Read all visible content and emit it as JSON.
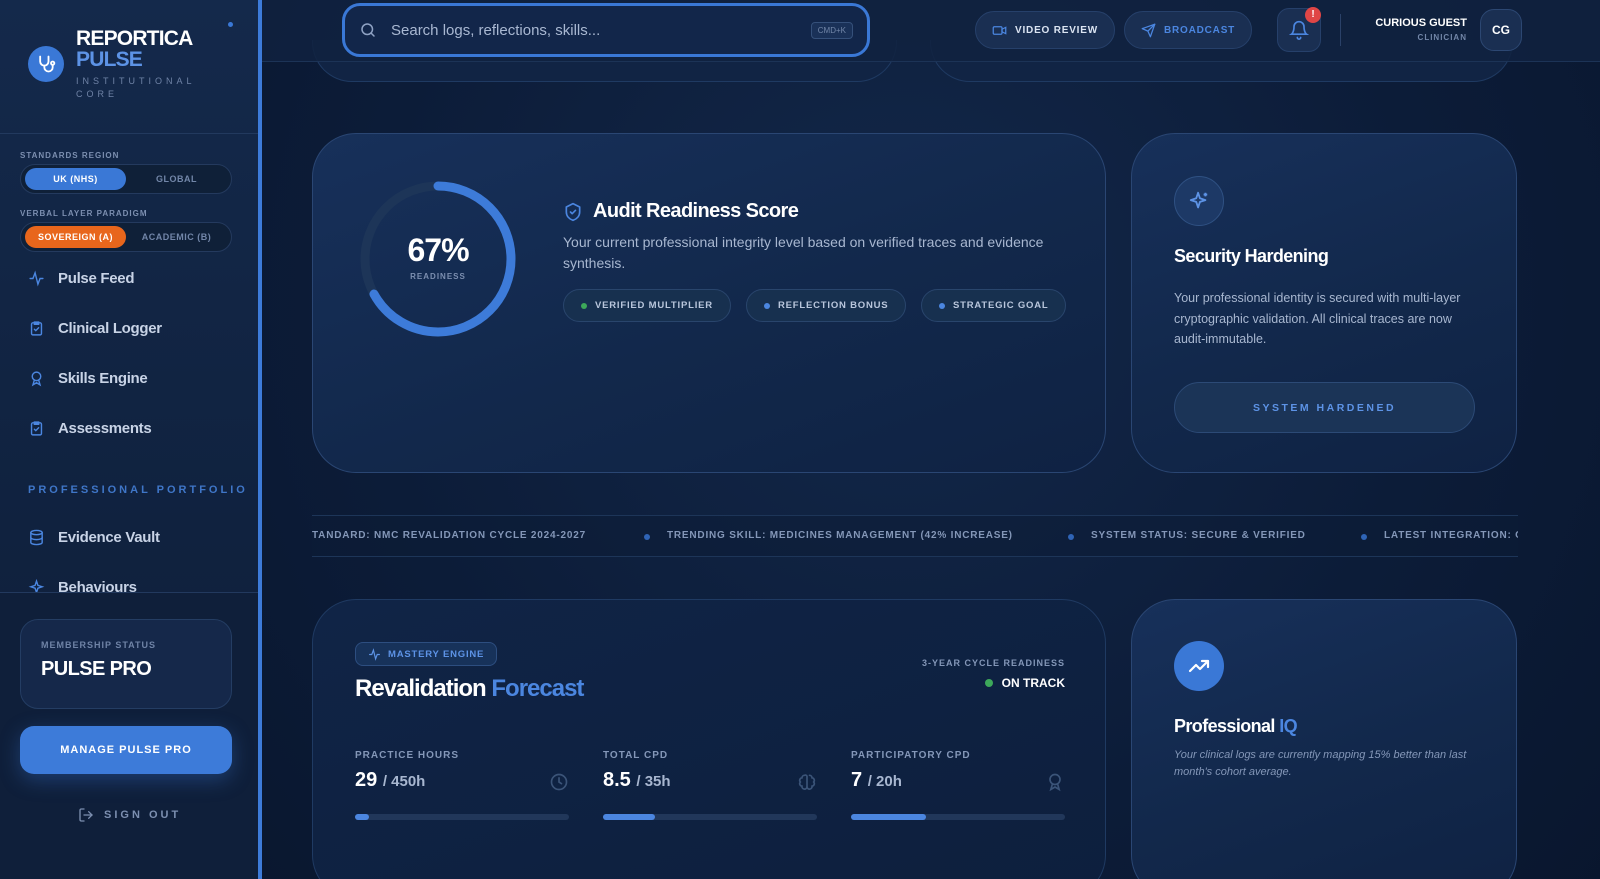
{
  "brand": {
    "name": "REPORTICA",
    "accent": "PULSE",
    "subtitle": "INSTITUTIONAL CORE"
  },
  "sidebar": {
    "standards_label": "STANDARDS REGION",
    "standards_options": [
      "UK (NHS)",
      "GLOBAL"
    ],
    "standards_selected": "UK (NHS)",
    "paradigm_label": "VERBAL LAYER PARADIGM",
    "paradigm_options": [
      "SOVEREIGN (A)",
      "ACADEMIC (B)"
    ],
    "paradigm_selected": "SOVEREIGN (A)",
    "nav": [
      {
        "label": "Pulse Feed",
        "icon": "activity-icon"
      },
      {
        "label": "Clinical Logger",
        "icon": "clipboard-check-icon"
      },
      {
        "label": "Skills Engine",
        "icon": "award-icon"
      },
      {
        "label": "Assessments",
        "icon": "clipboard-check-icon"
      }
    ],
    "portfolio_label": "PROFESSIONAL PORTFOLIO",
    "portfolio_nav": [
      {
        "label": "Evidence Vault",
        "icon": "database-icon"
      },
      {
        "label": "Behaviours",
        "icon": "sparkles-icon"
      }
    ],
    "membership_label": "MEMBERSHIP STATUS",
    "membership_value": "PULSE PRO",
    "manage_button": "MANAGE PULSE PRO",
    "sign_out": "SIGN OUT"
  },
  "topbar": {
    "search_placeholder": "Search logs, reflections, skills...",
    "search_shortcut": "CMD+K",
    "video_review": "VIDEO REVIEW",
    "broadcast": "BROADCAST",
    "notification_badge": "!",
    "user_name": "CURIOUS GUEST",
    "user_role": "CLINICIAN",
    "user_initials": "CG"
  },
  "audit": {
    "percent_text": "67%",
    "percent_value": 67,
    "percent_label": "READINESS",
    "title": "Audit Readiness Score",
    "description": "Your current professional integrity level based on verified traces and evidence synthesis.",
    "chips": [
      {
        "label": "VERIFIED MULTIPLIER",
        "color": "#3da85a"
      },
      {
        "label": "REFLECTION BONUS",
        "color": "#4b86e0"
      },
      {
        "label": "STRATEGIC GOAL",
        "color": "#4b86e0"
      }
    ]
  },
  "security": {
    "title": "Security Hardening",
    "description": "Your professional identity is secured with multi-layer cryptographic validation. All clinical traces are now audit-immutable.",
    "button": "SYSTEM HARDENED"
  },
  "ticker": [
    "TANDARD: NMC REVALIDATION CYCLE 2024-2027",
    "TRENDING SKILL: MEDICINES MANAGEMENT (42% INCREASE)",
    "SYSTEM STATUS: SECURE & VERIFIED",
    "LATEST INTEGRATION: O"
  ],
  "forecast": {
    "badge": "MASTERY ENGINE",
    "title": "Revalidation",
    "title_accent": "Forecast",
    "cycle_label": "3-YEAR CYCLE READINESS",
    "cycle_value": "ON TRACK",
    "metrics": [
      {
        "label": "PRACTICE HOURS",
        "value": "29",
        "target": "/ 450h",
        "progress": 0.064,
        "icon": "clock-icon"
      },
      {
        "label": "TOTAL CPD",
        "value": "8.5",
        "target": "/ 35h",
        "progress": 0.243,
        "icon": "brain-icon"
      },
      {
        "label": "PARTICIPATORY CPD",
        "value": "7",
        "target": "/ 20h",
        "progress": 0.35,
        "icon": "award-icon"
      }
    ]
  },
  "iq": {
    "title": "Professional",
    "title_accent": "IQ",
    "description": "Your clinical logs are currently mapping 15% better than last month's cohort average."
  },
  "colors": {
    "accent": "#3a78d6",
    "orange": "#e8661c",
    "green": "#3da85a",
    "alert": "#e04646"
  }
}
